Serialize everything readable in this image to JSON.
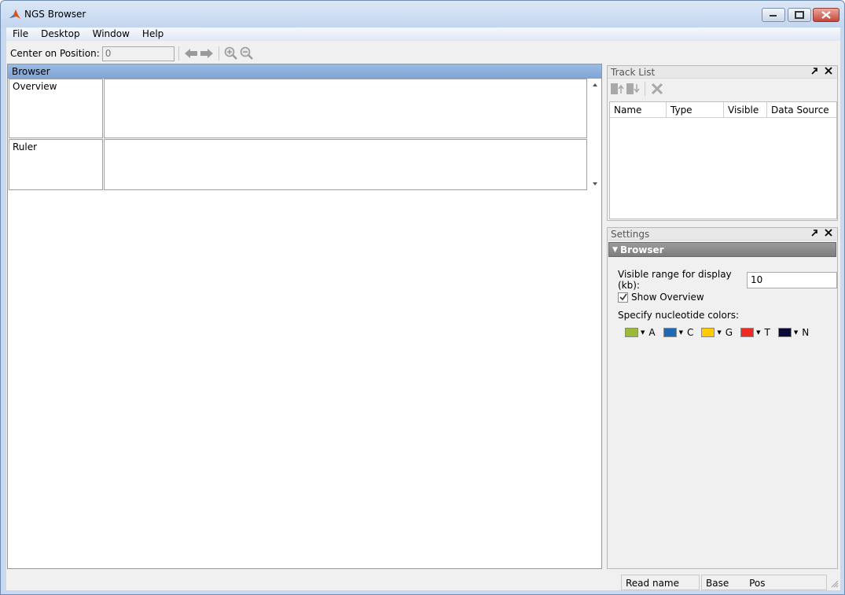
{
  "window": {
    "title": "NGS Browser"
  },
  "menu": {
    "items": [
      "File",
      "Desktop",
      "Window",
      "Help"
    ]
  },
  "toolbar": {
    "center_label": "Center on Position:",
    "center_placeholder": "0",
    "icons": [
      "back-arrow-icon",
      "forward-arrow-icon",
      "zoom-in-icon",
      "zoom-out-icon"
    ]
  },
  "browser": {
    "title": "Browser",
    "tracks": [
      "Overview",
      "Ruler"
    ]
  },
  "track_list": {
    "title": "Track List",
    "columns": [
      "Name",
      "Type",
      "Visible",
      "Data Source"
    ]
  },
  "settings": {
    "title": "Settings",
    "section": "Browser",
    "range_label": "Visible range for display (kb):",
    "range_value": "10",
    "show_overview_label": "Show Overview",
    "show_overview_checked": true,
    "nucleotide_label": "Specify nucleotide colors:",
    "nucleotides": [
      {
        "letter": "A",
        "color": "#9bbb37"
      },
      {
        "letter": "C",
        "color": "#1f69b6"
      },
      {
        "letter": "G",
        "color": "#ffcc00"
      },
      {
        "letter": "T",
        "color": "#ee2a24"
      },
      {
        "letter": "N",
        "color": "#0a0a3a"
      }
    ]
  },
  "status": {
    "read_name": "Read name",
    "base": "Base",
    "pos": "Pos"
  }
}
